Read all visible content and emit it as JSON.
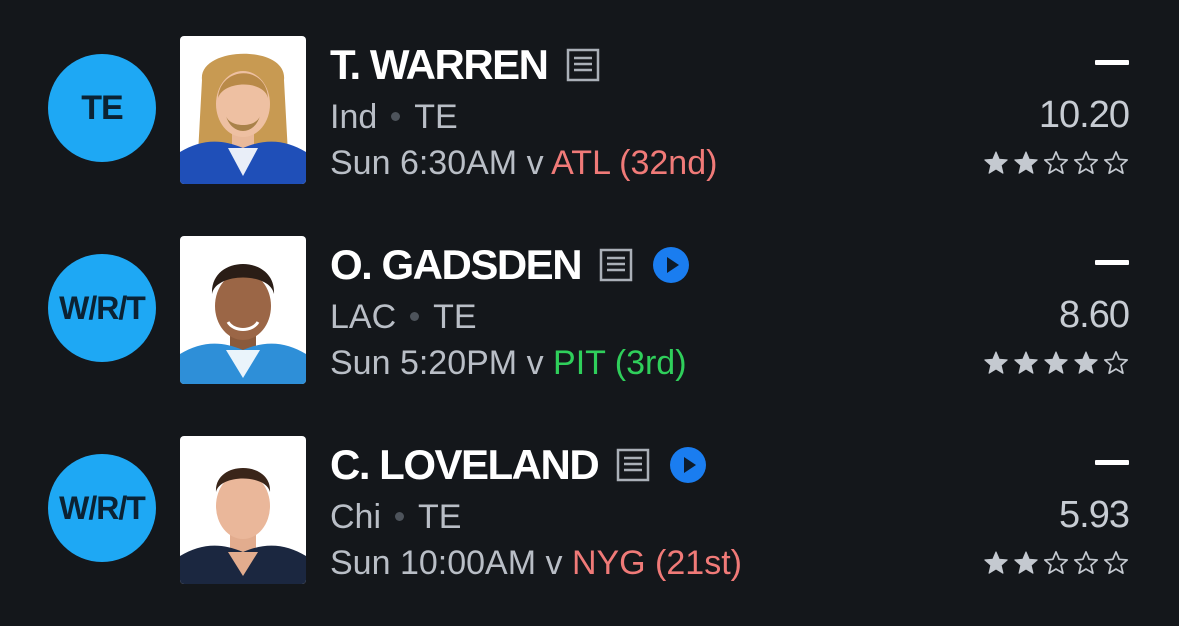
{
  "players": [
    {
      "slot": "TE",
      "name": "T. WARREN",
      "team": "Ind",
      "position": "TE",
      "game_prefix": "Sun 6:30AM v",
      "opponent": "ATL (32nd)",
      "opponent_rating": "bad",
      "salary_dash": "—",
      "projection": "10.20",
      "stars": 2,
      "has_video": false
    },
    {
      "slot": "W/R/T",
      "name": "O. GADSDEN",
      "team": "LAC",
      "position": "TE",
      "game_prefix": "Sun 5:20PM v",
      "opponent": "PIT (3rd)",
      "opponent_rating": "good",
      "salary_dash": "—",
      "projection": "8.60",
      "stars": 4,
      "has_video": true
    },
    {
      "slot": "W/R/T",
      "name": "C. LOVELAND",
      "team": "Chi",
      "position": "TE",
      "game_prefix": "Sun 10:00AM v",
      "opponent": "NYG (21st)",
      "opponent_rating": "bad",
      "salary_dash": "—",
      "projection": "5.93",
      "stars": 2,
      "has_video": true
    }
  ],
  "colors": {
    "background": "#14171b",
    "slot_circle": "#1ea8f4",
    "opponent_bad": "#f07a78",
    "opponent_good": "#2fcf5b",
    "play_button": "#1a7df0",
    "secondary_text": "#b9bec6"
  },
  "icons": {
    "notes": "player-notes-icon",
    "play": "play-video-icon",
    "star_filled": "star-filled-icon",
    "star_empty": "star-outline-icon"
  }
}
